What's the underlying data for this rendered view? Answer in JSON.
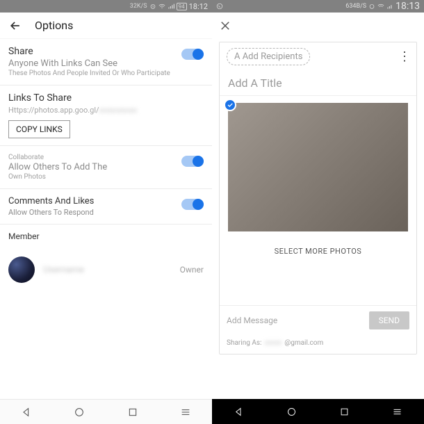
{
  "left": {
    "status": {
      "speed": "32K/S",
      "battery": "94",
      "time": "18:12"
    },
    "title": "Options",
    "share": {
      "label": "Share",
      "sub": "Anyone With Links Can See",
      "note": "These Photos And People Invited Or Who Participate"
    },
    "links": {
      "label": "Links To Share",
      "url": "Https://photos.app.goo.gl/",
      "copy": "COPY LINKS"
    },
    "collab": {
      "label": "Collaborate",
      "sub": "Allow Others To Add The",
      "note": "Own Photos"
    },
    "comments": {
      "label": "Comments And Likes",
      "sub": "Allow Others To Respond"
    },
    "member": {
      "label": "Member",
      "name": "Username",
      "role": "Owner"
    }
  },
  "right": {
    "status": {
      "speed": "634B/S",
      "time": "18:13"
    },
    "recipients": "A Add Recipients",
    "title": "Add A Title",
    "selectMore": "SELECT MORE PHOTOS",
    "message": "Add Message",
    "send": "SEND",
    "sharing": {
      "label": "Sharing As:",
      "email": "@gmail.com"
    }
  }
}
